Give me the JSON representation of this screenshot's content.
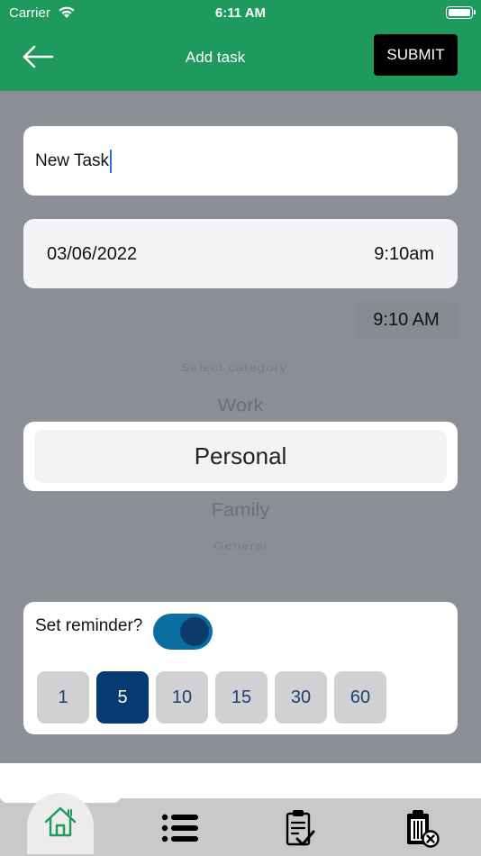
{
  "status_bar": {
    "carrier": "Carrier",
    "time": "6:11 AM"
  },
  "nav": {
    "title": "Add task",
    "submit_label": "SUBMIT"
  },
  "task": {
    "title_value": "New Task"
  },
  "schedule": {
    "date": "03/06/2022",
    "time": "9:10am",
    "time_chip": "9:10 AM"
  },
  "category_picker": {
    "placeholder": "Select category...",
    "options": [
      "Work",
      "Personal",
      "Family",
      "General"
    ],
    "selected": "Personal"
  },
  "reminder": {
    "label": "Set reminder?",
    "enabled": true,
    "options": [
      "1",
      "5",
      "10",
      "15",
      "30",
      "60"
    ],
    "selected": "5"
  },
  "tab_bar": {
    "icons": [
      "home-icon",
      "list-icon",
      "clipboard-check-icon",
      "clipboard-delete-icon"
    ],
    "active": "home-icon"
  },
  "colors": {
    "header": "#1e9a5c",
    "accent": "#073a70",
    "toggle": "#0a6fa0",
    "background": "#8c8e96"
  }
}
